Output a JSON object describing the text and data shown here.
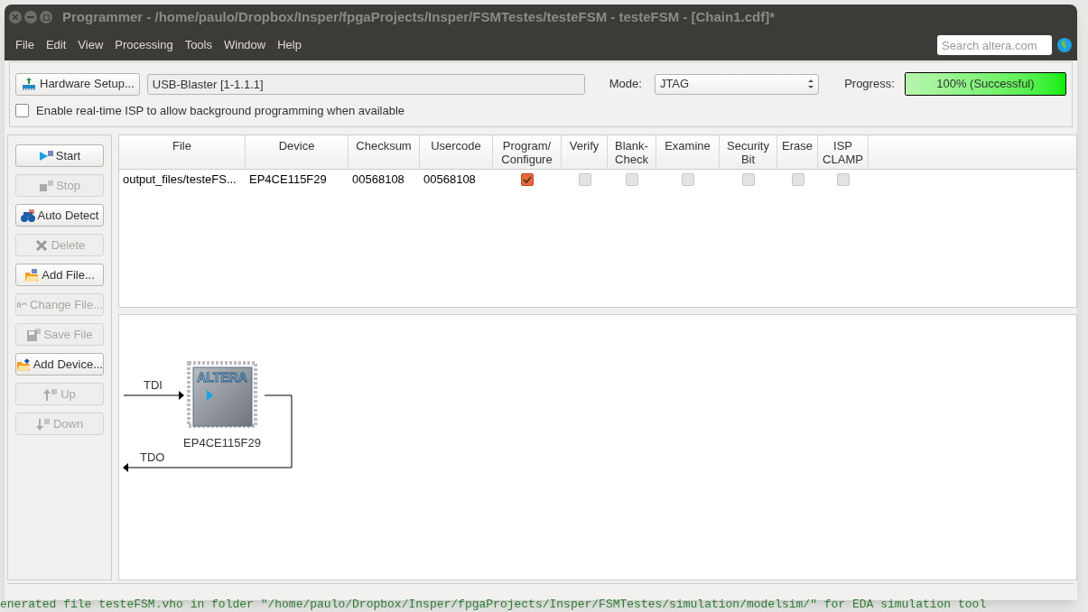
{
  "window": {
    "title": "Programmer - /home/paulo/Dropbox/Insper/fpgaProjects/Insper/FSMTestes/testeFSM - testeFSM - [Chain1.cdf]*"
  },
  "menu": [
    "File",
    "Edit",
    "View",
    "Processing",
    "Tools",
    "Window",
    "Help"
  ],
  "search": {
    "placeholder": "Search altera.com"
  },
  "hardware_button": "Hardware Setup...",
  "hardware_field": "USB-Blaster [1-1.1.1]",
  "mode": {
    "label": "Mode:",
    "value": "JTAG"
  },
  "progress": {
    "label": "Progress:",
    "level": 1,
    "text": "100% (Successful)"
  },
  "isp_option": {
    "label": "Enable real-time ISP to allow background programming when available",
    "checked": false
  },
  "side_buttons": [
    {
      "kind": "start",
      "label": "Start",
      "disabled": false
    },
    {
      "kind": "stop",
      "label": "Stop",
      "disabled": true
    },
    {
      "kind": "detect",
      "label": "Auto Detect",
      "disabled": false
    },
    {
      "kind": "delete",
      "label": "Delete",
      "disabled": true
    },
    {
      "kind": "addfile",
      "label": "Add File...",
      "disabled": false
    },
    {
      "kind": "change",
      "label": "Change File...",
      "disabled": true
    },
    {
      "kind": "save",
      "label": "Save File",
      "disabled": true
    },
    {
      "kind": "adddevice",
      "label": "Add Device...",
      "disabled": false
    },
    {
      "kind": "up",
      "label": "Up",
      "disabled": true
    },
    {
      "kind": "down",
      "label": "Down",
      "disabled": true
    }
  ],
  "table": {
    "columns": [
      "File",
      "Device",
      "Checksum",
      "Usercode",
      "Program/\nConfigure",
      "Verify",
      "Blank-\nCheck",
      "Examine",
      "Security\nBit",
      "Erase",
      "ISP\nCLAMP"
    ],
    "rows": [
      {
        "file": "output_files/testeFS...",
        "device": "EP4CE115F29",
        "checksum": "00568108",
        "usercode": "00568108",
        "options": [
          {
            "checked": true,
            "disabled": false
          },
          {
            "checked": false,
            "disabled": true
          },
          {
            "checked": false,
            "disabled": true
          },
          {
            "checked": false,
            "disabled": true
          },
          {
            "checked": false,
            "disabled": true
          },
          {
            "checked": false,
            "disabled": true
          },
          {
            "checked": false,
            "disabled": true
          }
        ]
      }
    ]
  },
  "chain": {
    "input": "TDI",
    "output": "TDO",
    "device": "EP4CE115F29",
    "chip_logo": "ALTERA"
  },
  "console_line": "enerated file testeFSM.vho in folder \"/home/paulo/Dropbox/Insper/fpgaProjects/Insper/FSMTestes/simulation/modelsim/\" for EDA simulation tool"
}
